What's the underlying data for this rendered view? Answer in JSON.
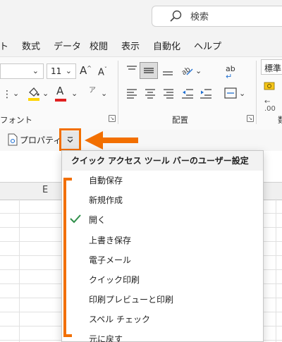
{
  "titlebar": {
    "search_placeholder": "検索"
  },
  "menu_tabs": [
    "ト",
    "数式",
    "データ",
    "校閲",
    "表示",
    "自動化",
    "ヘルプ"
  ],
  "ribbon": {
    "font_size": "11",
    "grow_font": "A",
    "shrink_font": "A",
    "font_group_label": "フォント",
    "align_group_label": "配置",
    "number_format": "標準",
    "font_color_glyph": "A",
    "phonetic_glyph": "ア",
    "wrap_glyph": "ab",
    "accent_orange": "#f26f00"
  },
  "qat": {
    "properties_label": "プロパティ"
  },
  "sheet": {
    "column_header": "E"
  },
  "dropdown": {
    "header": "クイック アクセス ツール バーのユーザー設定",
    "items": [
      {
        "label": "自動保存",
        "checked": false
      },
      {
        "label": "新規作成",
        "checked": false
      },
      {
        "label": "開く",
        "checked": true
      },
      {
        "label": "上書き保存",
        "checked": false
      },
      {
        "label": "電子メール",
        "checked": false
      },
      {
        "label": "クイック印刷",
        "checked": false
      },
      {
        "label": "印刷プレビューと印刷",
        "checked": false
      },
      {
        "label": "スペル チェック",
        "checked": false
      },
      {
        "label": "元に戻す",
        "checked": false
      }
    ]
  }
}
